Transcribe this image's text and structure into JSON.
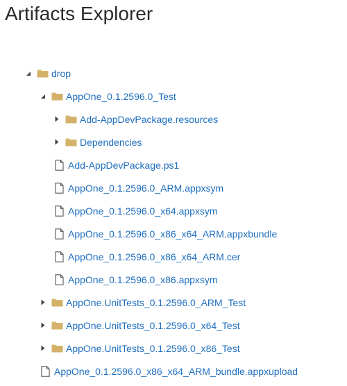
{
  "header": {
    "title": "Artifacts Explorer"
  },
  "colors": {
    "link": "#1f6fbf",
    "folder": "#d9b871",
    "toggle": "#444444"
  },
  "tree": [
    {
      "label": "drop",
      "type": "folder",
      "level": 0,
      "expanded": true
    },
    {
      "label": "AppOne_0.1.2596.0_Test",
      "type": "folder",
      "level": 1,
      "expanded": true
    },
    {
      "label": "Add-AppDevPackage.resources",
      "type": "folder",
      "level": 2,
      "expanded": false
    },
    {
      "label": "Dependencies",
      "type": "folder",
      "level": 2,
      "expanded": false
    },
    {
      "label": "Add-AppDevPackage.ps1",
      "type": "file",
      "level": 2
    },
    {
      "label": "AppOne_0.1.2596.0_ARM.appxsym",
      "type": "file",
      "level": 2
    },
    {
      "label": "AppOne_0.1.2596.0_x64.appxsym",
      "type": "file",
      "level": 2
    },
    {
      "label": "AppOne_0.1.2596.0_x86_x64_ARM.appxbundle",
      "type": "file",
      "level": 2
    },
    {
      "label": "AppOne_0.1.2596.0_x86_x64_ARM.cer",
      "type": "file",
      "level": 2
    },
    {
      "label": "AppOne_0.1.2596.0_x86.appxsym",
      "type": "file",
      "level": 2
    },
    {
      "label": "AppOne.UnitTests_0.1.2596.0_ARM_Test",
      "type": "folder",
      "level": 1,
      "expanded": false
    },
    {
      "label": "AppOne.UnitTests_0.1.2596.0_x64_Test",
      "type": "folder",
      "level": 1,
      "expanded": false
    },
    {
      "label": "AppOne.UnitTests_0.1.2596.0_x86_Test",
      "type": "folder",
      "level": 1,
      "expanded": false
    },
    {
      "label": "AppOne_0.1.2596.0_x86_x64_ARM_bundle.appxupload",
      "type": "file",
      "level": 1
    }
  ]
}
